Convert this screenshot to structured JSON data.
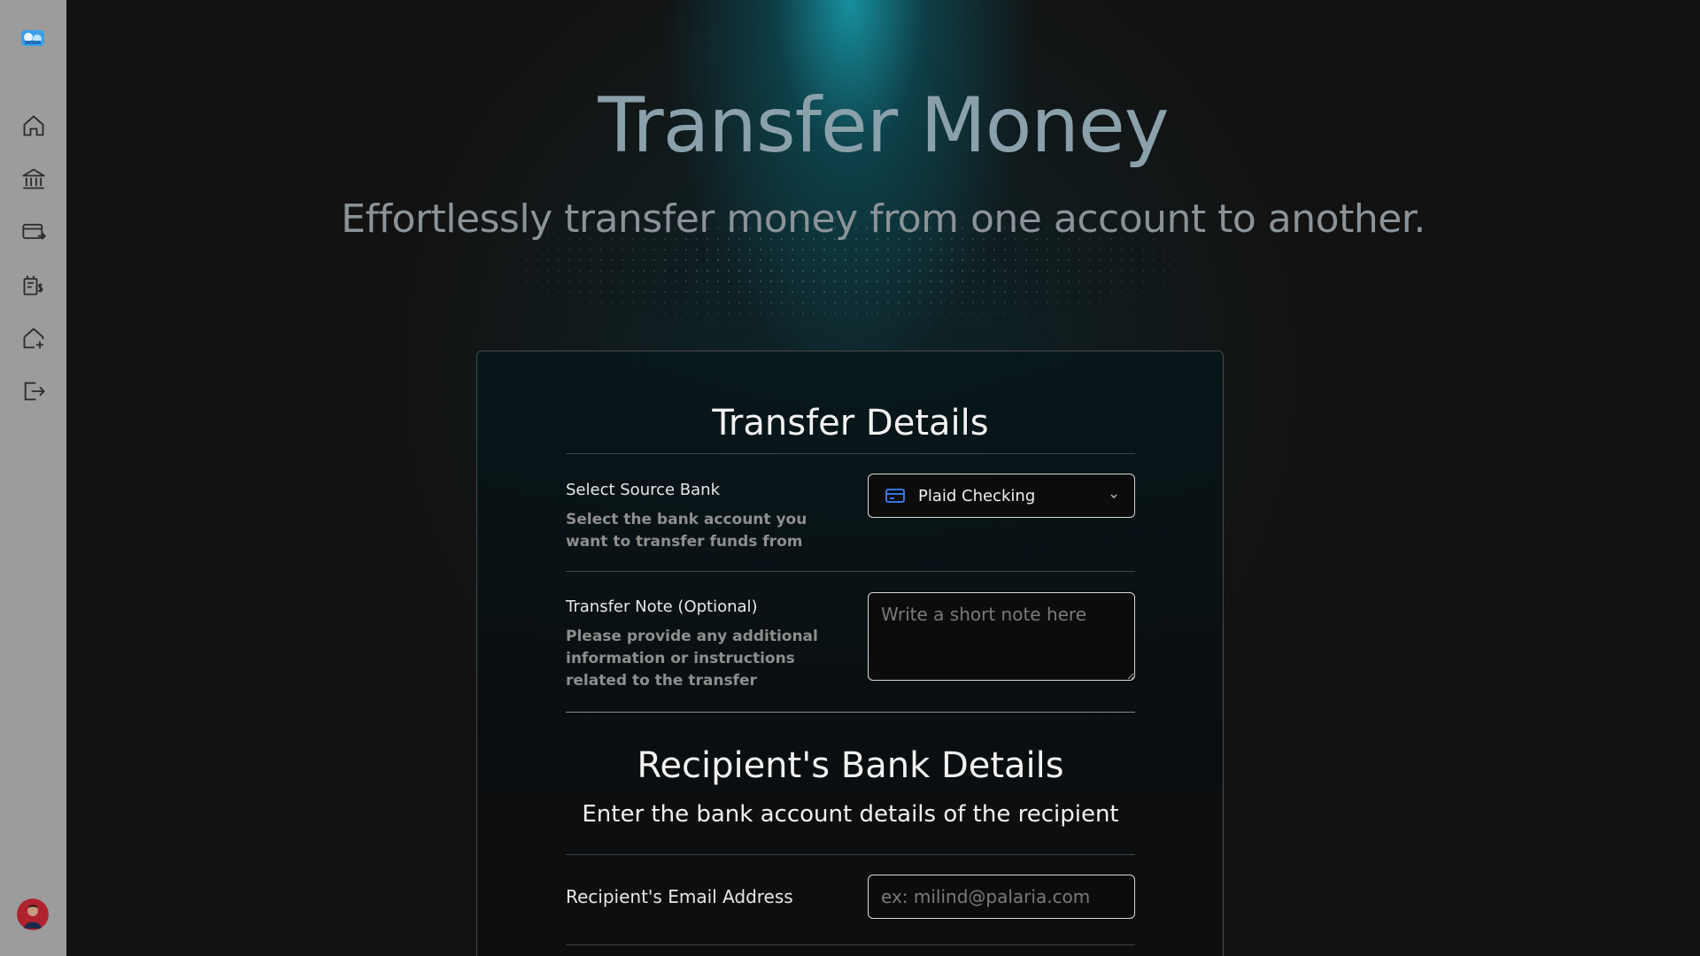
{
  "app": {
    "title": "Transfer Money",
    "subtitle": "Effortlessly transfer money from one account to another."
  },
  "sidebar": {
    "items": [
      {
        "icon": "home-icon"
      },
      {
        "icon": "bank-icon"
      },
      {
        "icon": "card-transfer-icon"
      },
      {
        "icon": "receipt-dollar-icon"
      },
      {
        "icon": "home-plus-icon"
      },
      {
        "icon": "logout-icon"
      }
    ]
  },
  "transfer_details": {
    "title": "Transfer Details",
    "source_bank": {
      "label": "Select Source Bank",
      "description": "Select the bank account you want to transfer funds from",
      "selected": "Plaid Checking"
    },
    "note": {
      "label": "Transfer Note (Optional)",
      "description": "Please provide any additional information or instructions related to the transfer",
      "placeholder": "Write a short note here",
      "value": ""
    }
  },
  "recipient": {
    "title": "Recipient's Bank Details",
    "subtitle": "Enter the bank account details of the recipient",
    "email": {
      "label": "Recipient's Email Address",
      "placeholder": "ex: milind@palaria.com",
      "value": ""
    }
  },
  "colors": {
    "sidebar_bg": "#9c9c9c",
    "page_bg": "#121212",
    "glow": "#1796a5",
    "accent_icon": "#3b82f6"
  }
}
